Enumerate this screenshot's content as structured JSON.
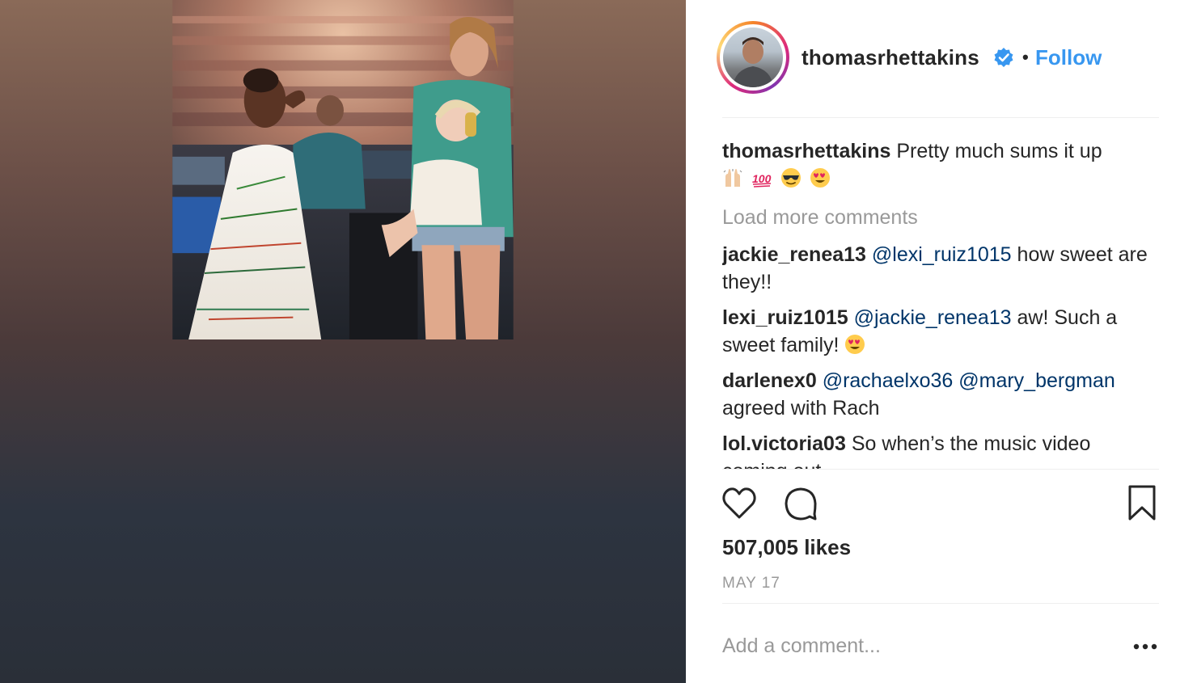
{
  "post": {
    "author": {
      "username": "thomasrhettakins",
      "verified": true,
      "follow_label": "Follow",
      "separator": "•"
    },
    "caption": {
      "username": "thomasrhettakins",
      "text": "Pretty much sums it up",
      "emojis": [
        "raised-hands",
        "hundred-points",
        "sunglasses-face",
        "heart-eyes-face"
      ]
    },
    "load_more_label": "Load more comments",
    "comments": [
      {
        "username": "jackie_renea13",
        "mentions": [
          "@lexi_ruiz1015"
        ],
        "text": "how sweet are they!!"
      },
      {
        "username": "lexi_ruiz1015",
        "mentions": [
          "@jackie_renea13"
        ],
        "text": "aw! Such a sweet family!",
        "emoji": "heart-eyes-face"
      },
      {
        "username": "darlenex0",
        "mentions": [
          "@rachaelxo36",
          "@mary_bergman"
        ],
        "text": "agreed with Rach"
      },
      {
        "username": "lol.victoria03",
        "mentions": [],
        "text": "So when’s the music video coming out"
      }
    ],
    "likes_text": "507,005 likes",
    "date": "MAY 17",
    "add_comment_placeholder": "Add a comment...",
    "icons": {
      "like": "heart-outline-icon",
      "comment": "comment-bubble-icon",
      "save": "bookmark-icon",
      "more": "more-options-icon",
      "verified": "verified-badge-icon"
    },
    "colors": {
      "link_blue": "#3897f0",
      "mention_blue": "#003569",
      "muted_gray": "#999999",
      "text": "#262626",
      "divider": "#efefef",
      "emoji_red": "#e0245e",
      "emoji_yellow": "#ffcc4d"
    }
  }
}
